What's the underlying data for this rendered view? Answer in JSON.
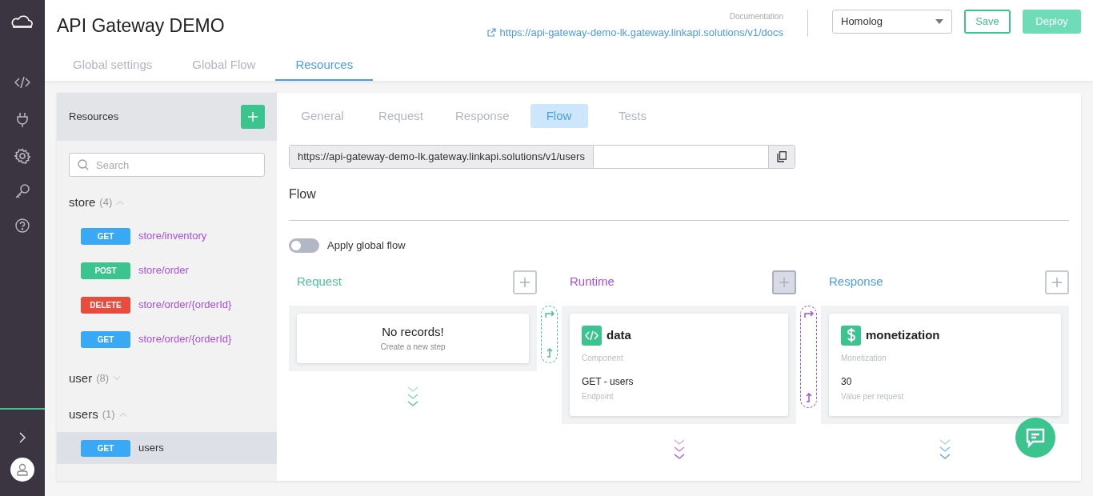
{
  "app": {
    "title": "API Gateway DEMO",
    "documentation_label": "Documentation",
    "documentation_url": "https://api-gateway-demo-lk.gateway.linkapi.solutions/v1/docs",
    "environment": "Homolog",
    "save_label": "Save",
    "deploy_label": "Deploy"
  },
  "top_tabs": [
    {
      "label": "Global settings",
      "selected": false
    },
    {
      "label": "Global Flow",
      "selected": false
    },
    {
      "label": "Resources",
      "selected": true
    }
  ],
  "resources": {
    "title": "Resources",
    "search_placeholder": "Search",
    "groups": [
      {
        "name": "store",
        "count": "(4)",
        "expanded": true,
        "endpoints": [
          {
            "method": "GET",
            "color": "#3aa9f5",
            "path": "store/inventory",
            "selected": false
          },
          {
            "method": "POST",
            "color": "#3cc48f",
            "path": "store/order",
            "selected": false
          },
          {
            "method": "DELETE",
            "color": "#e74c3c",
            "path": "store/order/{orderId}",
            "selected": false
          },
          {
            "method": "GET",
            "color": "#3aa9f5",
            "path": "store/order/{orderId}",
            "selected": false
          }
        ]
      },
      {
        "name": "user",
        "count": "(8)",
        "expanded": false
      },
      {
        "name": "users",
        "count": "(1)",
        "expanded": true,
        "endpoints": [
          {
            "method": "GET",
            "color": "#3aa9f5",
            "path": "users",
            "selected": true
          }
        ]
      }
    ]
  },
  "resource_tabs": [
    {
      "label": "General",
      "selected": false
    },
    {
      "label": "Request",
      "selected": false
    },
    {
      "label": "Response",
      "selected": false
    },
    {
      "label": "Flow",
      "selected": true
    },
    {
      "label": "Tests",
      "selected": false
    }
  ],
  "url": "https://api-gateway-demo-lk.gateway.linkapi.solutions/v1/users",
  "section_title": "Flow",
  "global_flow": {
    "label": "Apply global flow",
    "on": false
  },
  "columns": [
    {
      "title": "Request",
      "color": "#4cc096",
      "add_hovered": false,
      "empty": {
        "title": "No records!",
        "hint": "Create a new step"
      }
    },
    {
      "title": "Runtime",
      "color": "#a450e0",
      "add_hovered": true,
      "steps": [
        {
          "kind": "code",
          "name": "data",
          "type": "Component",
          "value": "GET - users",
          "value_label": "Endpoint"
        }
      ]
    },
    {
      "title": "Response",
      "color": "#4a9ee8",
      "add_hovered": false,
      "steps": [
        {
          "kind": "money",
          "name": "monetization",
          "type": "Monetization",
          "value": "30",
          "value_label": "Value per request"
        }
      ]
    }
  ]
}
